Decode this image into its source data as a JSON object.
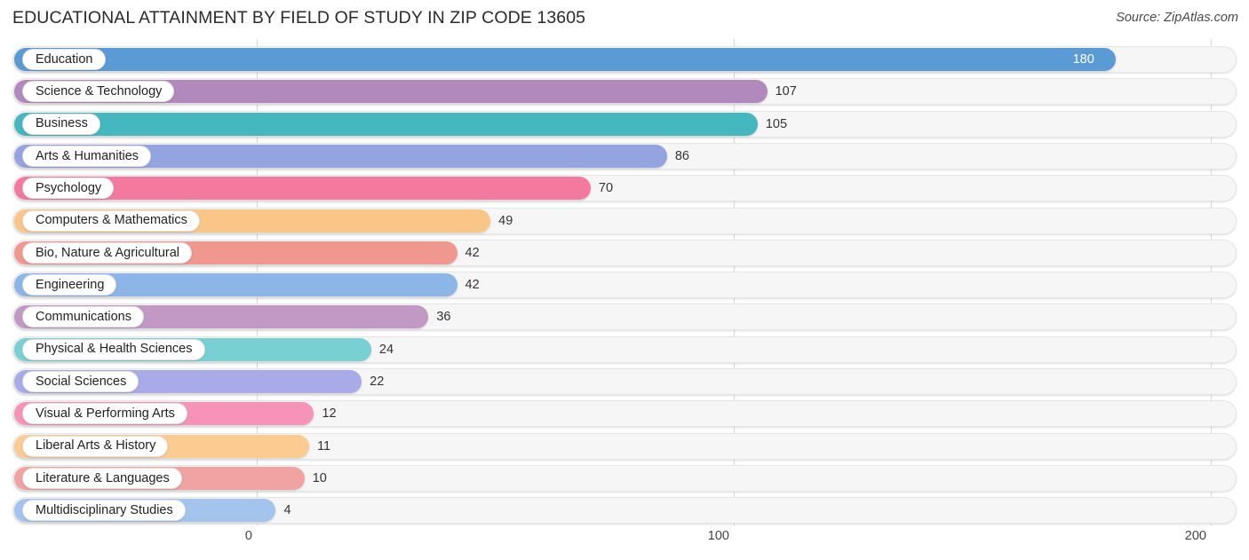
{
  "header": {
    "title": "EDUCATIONAL ATTAINMENT BY FIELD OF STUDY IN ZIP CODE 13605",
    "source": "Source: ZipAtlas.com"
  },
  "chart_data": {
    "type": "bar",
    "orientation": "horizontal",
    "title": "EDUCATIONAL ATTAINMENT BY FIELD OF STUDY IN ZIP CODE 13605",
    "subtitle": "",
    "xlabel": "",
    "ylabel": "",
    "xlim": [
      0,
      200
    ],
    "xticks": [
      0,
      100,
      200
    ],
    "xtick_labels": [
      "0",
      "100",
      "200"
    ],
    "grid": true,
    "legend": false,
    "categories": [
      "Education",
      "Science & Technology",
      "Business",
      "Arts & Humanities",
      "Psychology",
      "Computers & Mathematics",
      "Bio, Nature & Agricultural",
      "Engineering",
      "Communications",
      "Physical & Health Sciences",
      "Social Sciences",
      "Visual & Performing Arts",
      "Liberal Arts & History",
      "Literature & Languages",
      "Multidisciplinary Studies"
    ],
    "values": [
      180,
      107,
      105,
      86,
      70,
      49,
      42,
      42,
      36,
      24,
      22,
      12,
      11,
      10,
      4
    ],
    "value_labels": [
      "180",
      "107",
      "105",
      "86",
      "70",
      "49",
      "42",
      "42",
      "36",
      "24",
      "22",
      "12",
      "11",
      "10",
      "4"
    ],
    "colors": [
      "#5b9bd5",
      "#b289bd",
      "#45b7bf",
      "#93a4e0",
      "#f4799f",
      "#fac687",
      "#f0978f",
      "#8cb6e8",
      "#c299c4",
      "#79d0d3",
      "#a8abe8",
      "#f793b8",
      "#fbcb91",
      "#f0a3a0",
      "#a3c4ec"
    ]
  },
  "axis": {
    "ticks": [
      "0",
      "100",
      "200"
    ]
  }
}
